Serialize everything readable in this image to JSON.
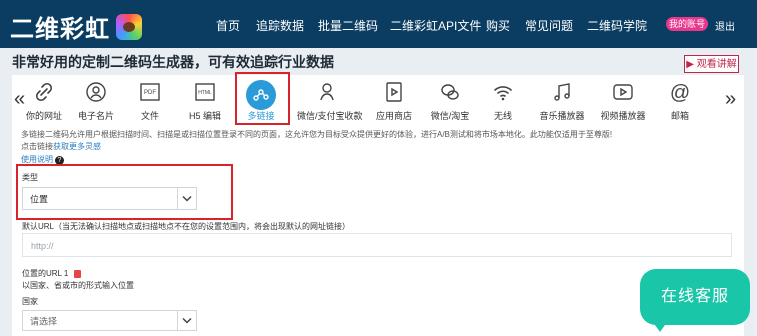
{
  "header": {
    "logo_text": "二维彩虹",
    "nav": [
      "首页",
      "追踪数据",
      "批量二维码",
      "二维彩虹API文件",
      "购买",
      "常见问题",
      "二维码学院"
    ],
    "account_label": "我的账号",
    "logout_label": "退出"
  },
  "page": {
    "headline": "非常好用的定制二维码生成器，可有效追踪行业数据",
    "watch_label": "▶ 观看讲解"
  },
  "types": [
    {
      "label": "你的网址",
      "icon": "link-icon"
    },
    {
      "label": "电子名片",
      "icon": "person-icon"
    },
    {
      "label": "文件",
      "icon": "pdf-icon"
    },
    {
      "label": "H5 编辑",
      "icon": "html-icon"
    },
    {
      "label": "多链接",
      "icon": "multi-link-icon",
      "active": true
    },
    {
      "label": "微信/支付宝收款",
      "icon": "payment-icon"
    },
    {
      "label": "应用商店",
      "icon": "app-store-icon"
    },
    {
      "label": "微信/淘宝",
      "icon": "wechat-icon"
    },
    {
      "label": "无线",
      "icon": "wifi-icon"
    },
    {
      "label": "音乐播放器",
      "icon": "music-icon"
    },
    {
      "label": "视频播放器",
      "icon": "video-icon"
    },
    {
      "label": "邮箱",
      "icon": "email-icon"
    }
  ],
  "description": {
    "line1": "多链接二维码允许用户根据扫描时间、扫描是或扫描位置登录不同的页面，这允许您为目标受众提供更好的体验，进行A/B测试和将市场本地化。此功能仅适用于至尊版!",
    "line2_prefix": "点击链接",
    "line2_link": "获取更多灵感",
    "help_label": "使用说明"
  },
  "form": {
    "type_label": "类型",
    "type_value": "位置",
    "default_url_label": "默认URL（当无法确认扫描地点或扫描地点不在您的设置范围内，将会出现默认的网址链接）",
    "default_url_placeholder": "http://",
    "location_url_title": "位置的URL 1",
    "location_url_desc": "以国家、省或市的形式输入位置",
    "country_label": "国家",
    "country_value": "请选择"
  },
  "chat": {
    "label": "在线客服"
  }
}
